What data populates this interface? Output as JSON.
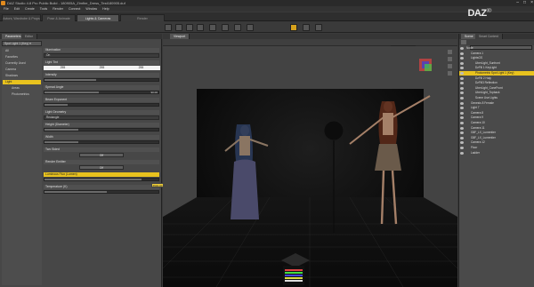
{
  "app": {
    "title": "DAZ Studio 4.8 Pro Public Build - 180905A_Zimfire_Dress_Test180905.duf",
    "logo_main": "DAZ",
    "logo_sup": "3D"
  },
  "menus": [
    "File",
    "Edit",
    "Create",
    "Tools",
    "Render",
    "Connect",
    "Window",
    "Help"
  ],
  "top_tabs": [
    "Actors, Wardrobe & Props",
    "Pose & Animate",
    "Lights & Cameras",
    "Render"
  ],
  "left_panel": {
    "tabs": [
      "Parameters",
      "Editor"
    ],
    "preset": "Spot Light 1 (Key)",
    "nodes": [
      "All",
      "Favorites",
      "Currently Used",
      "Camera",
      "Shadows",
      "Light",
      "Areas",
      "Photometrics"
    ],
    "selected_node": "Light",
    "properties": {
      "illumination_label": "Illumination",
      "illumination_value": "On",
      "tint_label": "Light Tint",
      "tint_r": "255",
      "tint_g": "255",
      "tint_b": "255",
      "intensity_label": "Intensity",
      "spread_label": "Spread Angle",
      "spread_value": "90.00",
      "beam_label": "Beam Exponent",
      "geometry_label": "Light Geometry",
      "geometry_value": "Rectangle",
      "height_label": "Height (Diameter)",
      "width_label": "Width",
      "twosided_label": "Two Sided",
      "twosided_value": "Off",
      "render_label": "Render Emitter",
      "render_value": "Off",
      "lumflux_label": "Luminous Flux (Lumen)",
      "temperature_label": "Temperature (K)",
      "tooltip": "6500.00"
    }
  },
  "viewport": {
    "tab": "Viewport",
    "camera": "Camera 11"
  },
  "scene": {
    "tabs": [
      "Scene",
      "Smart Content"
    ],
    "nodes": [
      {
        "label": "Node",
        "depth": 0,
        "selected": false
      },
      {
        "label": "Camera 1",
        "depth": 1,
        "selected": false
      },
      {
        "label": "LightsGS",
        "depth": 1,
        "selected": false
      },
      {
        "label": "UberLight_Sunfront",
        "depth": 2,
        "selected": false
      },
      {
        "label": "DzFill 1 KeyLight",
        "depth": 2,
        "selected": false
      },
      {
        "label": "Photometric Spot Light 1 (Key)",
        "depth": 2,
        "selected": true
      },
      {
        "label": "DzFill 2 Haly",
        "depth": 2,
        "selected": false
      },
      {
        "label": "DzFill3 Reflection",
        "depth": 2,
        "selected": false
      },
      {
        "label": "UberLight_ConeFront",
        "depth": 2,
        "selected": false
      },
      {
        "label": "UberLight_Topback",
        "depth": 2,
        "selected": false
      },
      {
        "label": "Scene Use Lights",
        "depth": 2,
        "selected": false
      },
      {
        "label": "Genesis 8 Female",
        "depth": 1,
        "selected": false
      },
      {
        "label": "Light 7",
        "depth": 1,
        "selected": false
      },
      {
        "label": "Camera 8",
        "depth": 1,
        "selected": false
      },
      {
        "label": "Camera 9",
        "depth": 1,
        "selected": false
      },
      {
        "label": "Camera 10",
        "depth": 1,
        "selected": false
      },
      {
        "label": "Camera 11",
        "depth": 1,
        "selected": false
      },
      {
        "label": "G8F_LX_Lumentier",
        "depth": 1,
        "selected": false
      },
      {
        "label": "G8F_LX_Lumentier",
        "depth": 1,
        "selected": false
      },
      {
        "label": "Camera 12",
        "depth": 1,
        "selected": false
      },
      {
        "label": "Floor",
        "depth": 1,
        "selected": false
      },
      {
        "label": "Ladder",
        "depth": 1,
        "selected": false
      }
    ]
  },
  "colors": {
    "accent": "#e8c21e",
    "panel": "#474747",
    "dark": "#2a2a2a"
  },
  "icons": [
    "app-icon",
    "minimize-icon",
    "maximize-icon",
    "close-icon",
    "eye-icon",
    "view-cube-icon",
    "camera-icon",
    "light-icon"
  ]
}
